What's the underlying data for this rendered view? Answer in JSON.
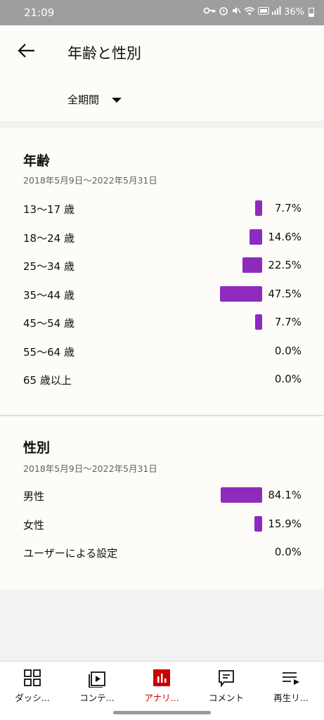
{
  "status": {
    "time": "21:09",
    "battery": "36%"
  },
  "header": {
    "title": "年齢と性別",
    "period": "全期間"
  },
  "age": {
    "title": "年齢",
    "date_range": "2018年5月9日～2022年5月31日",
    "rows": [
      {
        "label": "13～17 歳",
        "value": "7.7%",
        "fraction": 0.077
      },
      {
        "label": "18～24 歳",
        "value": "14.6%",
        "fraction": 0.146
      },
      {
        "label": "25～34 歳",
        "value": "22.5%",
        "fraction": 0.225
      },
      {
        "label": "35～44 歳",
        "value": "47.5%",
        "fraction": 0.475
      },
      {
        "label": "45～54 歳",
        "value": "7.7%",
        "fraction": 0.077
      },
      {
        "label": "55～64 歳",
        "value": "0.0%",
        "fraction": 0.0
      },
      {
        "label": "65 歳以上",
        "value": "0.0%",
        "fraction": 0.0
      }
    ]
  },
  "gender": {
    "title": "性別",
    "date_range": "2018年5月9日～2022年5月31日",
    "rows": [
      {
        "label": "男性",
        "value": "84.1%",
        "fraction": 0.841
      },
      {
        "label": "女性",
        "value": "15.9%",
        "fraction": 0.159
      },
      {
        "label": "ユーザーによる設定",
        "value": "0.0%",
        "fraction": 0.0
      }
    ]
  },
  "nav": {
    "items": [
      {
        "label": "ダッシ...",
        "icon": "dashboard-icon"
      },
      {
        "label": "コンテ...",
        "icon": "content-icon"
      },
      {
        "label": "アナリ...",
        "icon": "analytics-icon",
        "active": true
      },
      {
        "label": "コメント",
        "icon": "comment-icon"
      },
      {
        "label": "再生リ...",
        "icon": "playlist-icon"
      }
    ]
  },
  "colors": {
    "bar": "#8e2bbf",
    "active_nav": "#cc0000"
  }
}
